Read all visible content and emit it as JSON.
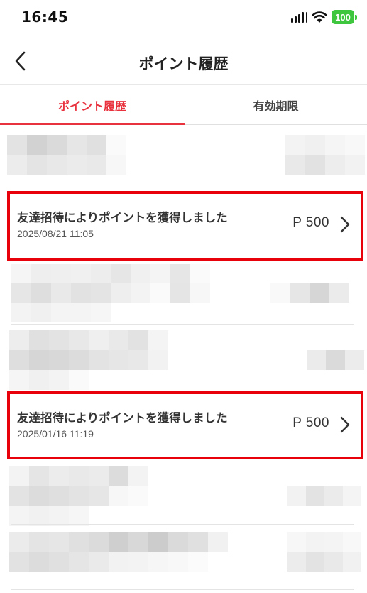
{
  "status_bar": {
    "time": "16:45",
    "battery": "100",
    "icons": [
      "signal-icon",
      "wifi-icon",
      "battery-icon"
    ],
    "battery_color": "#3ec63e"
  },
  "header": {
    "title": "ポイント履歴",
    "back_icon": "chevron-left-icon"
  },
  "tabs": [
    {
      "label": "ポイント履歴",
      "active": true
    },
    {
      "label": "有効期限",
      "active": false
    }
  ],
  "accent_color": "#e8333f",
  "highlight_color": "#e8000b",
  "history": [
    {
      "title": "友達招待によりポイントを獲得しました",
      "date": "2025/08/21 11:05",
      "points": "P 500"
    },
    {
      "title": "友達招待によりポイントを獲得しました",
      "date": "2025/01/16 11:19",
      "points": "P 500"
    }
  ]
}
